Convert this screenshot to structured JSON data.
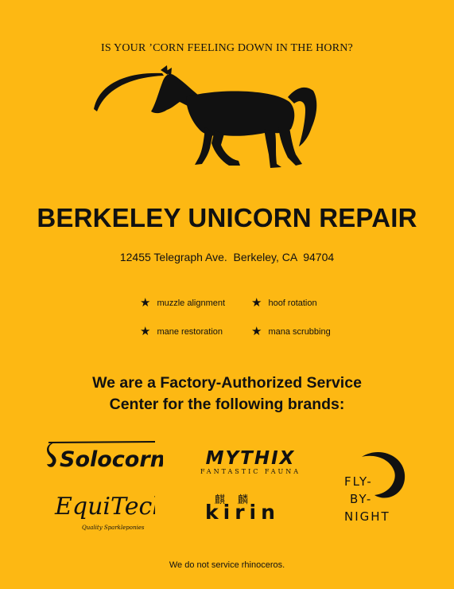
{
  "tagline": "IS YOUR ’CORN FEELING DOWN IN THE HORN?",
  "business_name": "BERKELEY UNICORN REPAIR",
  "address": "12455 Telegraph Ave.  Berkeley, CA  94704",
  "services": [
    {
      "label": "muzzle alignment"
    },
    {
      "label": "hoof rotation"
    },
    {
      "label": "mane restoration"
    },
    {
      "label": "mana scrubbing"
    }
  ],
  "authorized_line1": "We are a Factory-Authorized Service",
  "authorized_line2": "Center for the following brands:",
  "brands": {
    "solocorn": "Solocorn",
    "mythix": "MYTHIX",
    "mythix_sub": "FANTASTIC FAUNA",
    "equitech": "EquiTech",
    "equitech_sub": "Quality Sparkleponies",
    "kirin": "kirin",
    "kirin_glyphs": "麒麟",
    "flybynight_1": "FLY-",
    "flybynight_2": "BY-",
    "flybynight_3": "NIGHT"
  },
  "footer": "We do not service rhinoceros.",
  "colors": {
    "background": "#fdb813",
    "ink": "#111111"
  },
  "icons": {
    "service_bullet": "star-icon",
    "hero": "unicorn-silhouette"
  }
}
